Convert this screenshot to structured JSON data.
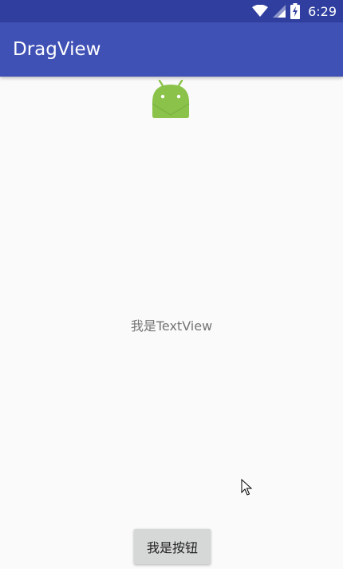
{
  "status_bar": {
    "time": "6:29",
    "icons": [
      "wifi-icon",
      "signal-icon",
      "battery-charging-icon"
    ]
  },
  "app_bar": {
    "title": "DragView"
  },
  "content": {
    "image_icon": "android-robot-icon",
    "text_view": "我是TextView",
    "button_label": "我是按钮"
  },
  "colors": {
    "status_bar": "#303f9f",
    "app_bar": "#3f51b5",
    "background": "#fafafa",
    "android_green": "#8bc34a",
    "button": "#d6d7d7"
  }
}
